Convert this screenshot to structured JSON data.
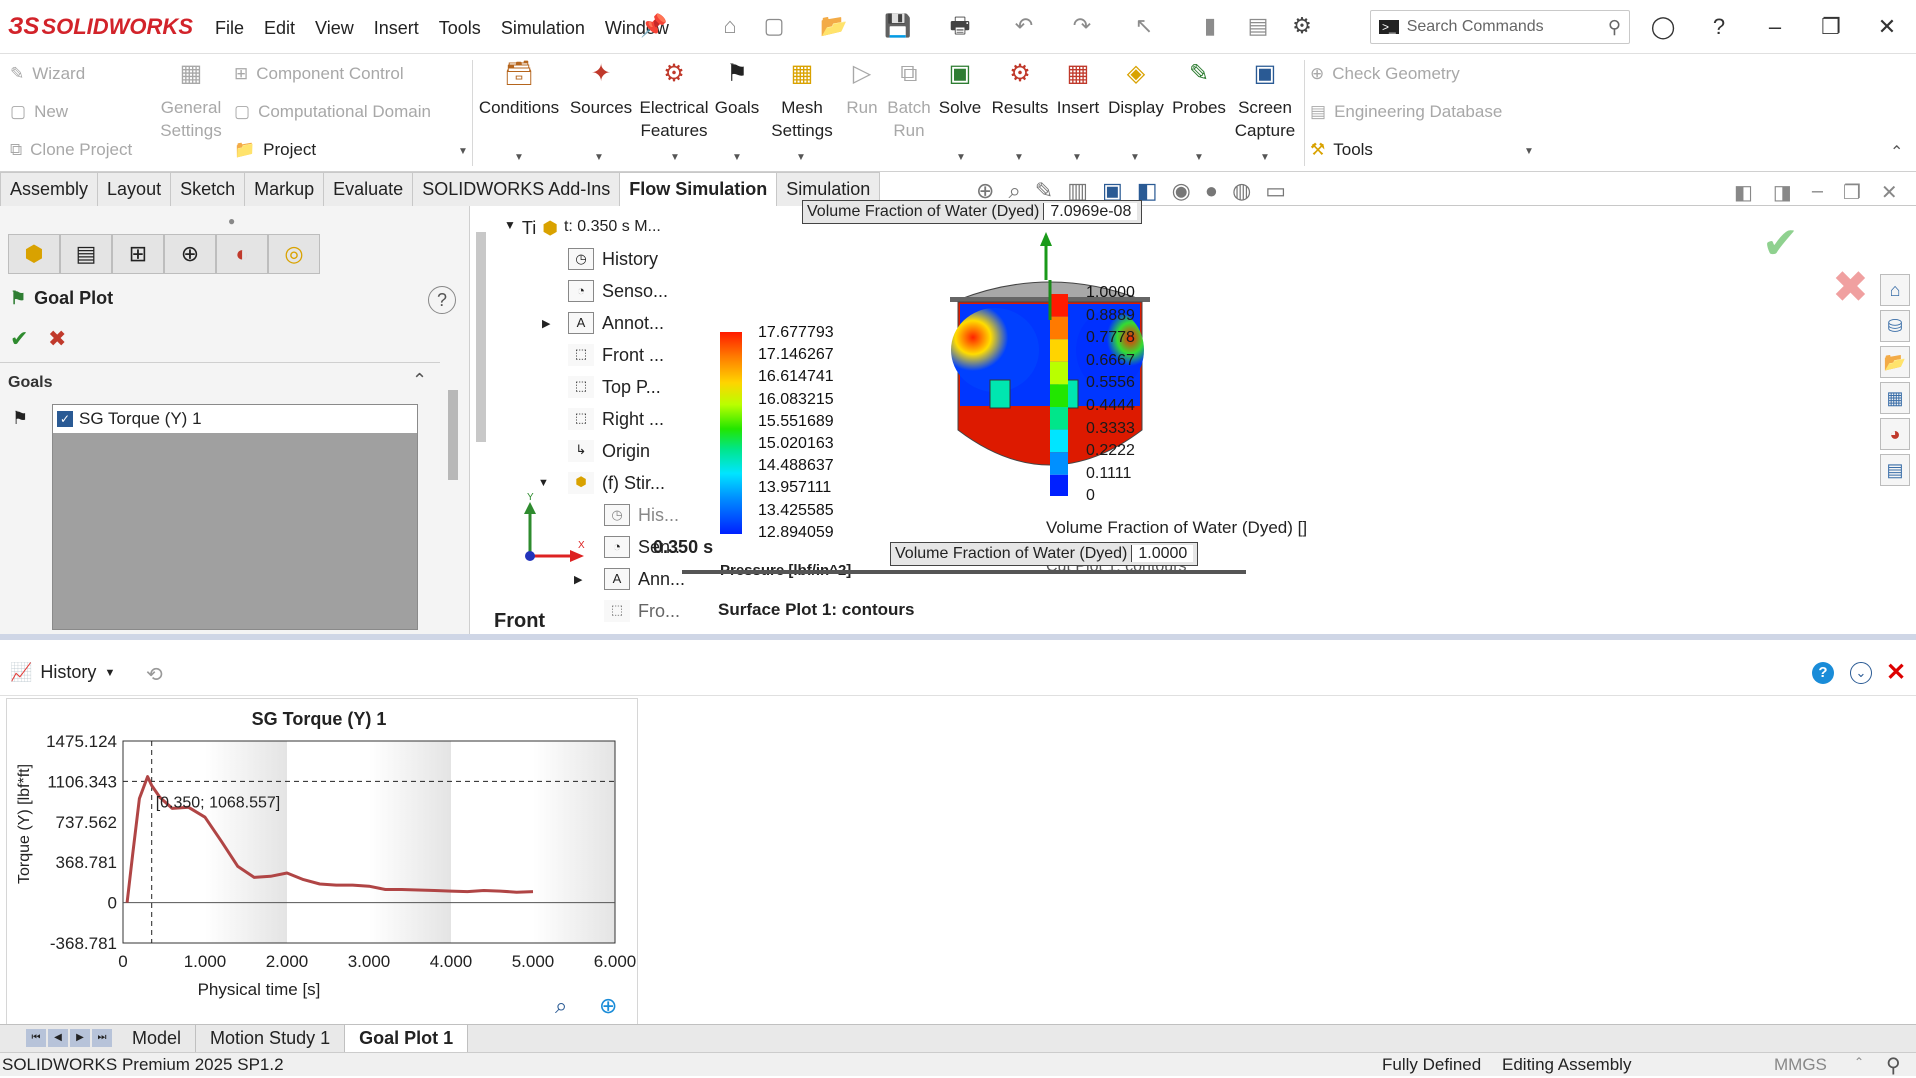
{
  "app": {
    "brand": "SOLIDWORKS",
    "brand_color": "#d2232a"
  },
  "menu": [
    "File",
    "Edit",
    "View",
    "Insert",
    "Tools",
    "Simulation",
    "Window"
  ],
  "search": {
    "placeholder": "Search Commands"
  },
  "ribbon": {
    "left_items": [
      "Wizard",
      "New",
      "Clone Project"
    ],
    "general_settings": [
      "General",
      "Settings"
    ],
    "mid_items": [
      "Component Control",
      "Computational Domain",
      "Project"
    ],
    "buttons": [
      {
        "l1": "Conditions",
        "l2": ""
      },
      {
        "l1": "Sources",
        "l2": ""
      },
      {
        "l1": "Electrical",
        "l2": "Features"
      },
      {
        "l1": "Goals",
        "l2": ""
      },
      {
        "l1": "Mesh",
        "l2": "Settings"
      },
      {
        "l1": "Run",
        "l2": ""
      },
      {
        "l1": "Batch",
        "l2": "Run"
      },
      {
        "l1": "Solve",
        "l2": ""
      },
      {
        "l1": "Results",
        "l2": ""
      },
      {
        "l1": "Insert",
        "l2": ""
      },
      {
        "l1": "Display",
        "l2": ""
      },
      {
        "l1": "Probes",
        "l2": ""
      },
      {
        "l1": "Screen",
        "l2": "Capture"
      }
    ],
    "right_items": [
      "Check Geometry",
      "Engineering Database",
      "Tools"
    ]
  },
  "tabs": [
    "Assembly",
    "Layout",
    "Sketch",
    "Markup",
    "Evaluate",
    "SOLIDWORKS Add-Ins",
    "Flow Simulation",
    "Simulation"
  ],
  "active_tab": "Flow Simulation",
  "panel": {
    "title": "Goal Plot",
    "section": "Goals",
    "goal_item": "SG Torque (Y) 1"
  },
  "tree": {
    "top": "Ti",
    "overlay": "t: 0.350 s M...",
    "items": [
      "History",
      "Senso...",
      "Annot...",
      "Front ...",
      "Top P...",
      "Right ...",
      "Origin",
      "(f) Stir...",
      "His...",
      "Sen...",
      "Ann...",
      "Fro..."
    ],
    "overlay_time": "0.350 s",
    "view_label": "Front"
  },
  "legend": {
    "values": [
      "17.677793",
      "17.146267",
      "16.614741",
      "16.083215",
      "15.551689",
      "15.020163",
      "14.488637",
      "13.957111",
      "13.425585",
      "12.894059"
    ],
    "unit_label": "Pressure [lbf/in^2]",
    "surface_label": "Surface Plot 1: contours"
  },
  "viewport": {
    "tooltip1_label": "Volume Fraction of Water (Dyed)",
    "tooltip1_value": "7.0969e-08",
    "tooltip2_label": "Volume Fraction of Water (Dyed)",
    "tooltip2_value": "1.0000",
    "scale_values": [
      "1.0000",
      "0.8889",
      "0.7778",
      "0.6667",
      "0.5556",
      "0.4444",
      "0.3333",
      "0.2222",
      "0.1111",
      "0"
    ],
    "scale_title": "Volume Fraction of Water (Dyed) []",
    "cut_label": "Cut Plot 1: contours",
    "axis_x": "X",
    "axis_y": "Y"
  },
  "history_bar": {
    "label": "History"
  },
  "chart_data": {
    "type": "line",
    "title": "SG Torque (Y) 1",
    "xlabel": "Physical time [s]",
    "ylabel": "Torque (Y) [lbf*ft]",
    "xlim": [
      0,
      6
    ],
    "ylim": [
      -368.781,
      1475.124
    ],
    "x_ticks": [
      "0",
      "1.000",
      "2.000",
      "3.000",
      "4.000",
      "5.000",
      "6.000"
    ],
    "y_ticks": [
      "1475.124",
      "1106.343",
      "737.562",
      "368.781",
      "0",
      "-368.781"
    ],
    "series": [
      {
        "color": "#b04545",
        "x": [
          0.05,
          0.12,
          0.2,
          0.3,
          0.35,
          0.45,
          0.6,
          0.8,
          1.0,
          1.2,
          1.4,
          1.6,
          1.8,
          2.0,
          2.2,
          2.4,
          2.6,
          2.8,
          3.0,
          3.2,
          3.4,
          3.6,
          3.8,
          4.0,
          4.2,
          4.4,
          4.6,
          4.8,
          5.0
        ],
        "y": [
          0,
          450,
          950,
          1150,
          1068.557,
          960,
          860,
          870,
          780,
          560,
          330,
          230,
          240,
          270,
          210,
          170,
          160,
          160,
          150,
          120,
          120,
          115,
          110,
          105,
          100,
          110,
          105,
          95,
          100
        ]
      }
    ],
    "annotation": "[0.350; 1068.557]",
    "marker": {
      "x": 0.35,
      "y": 1068.557
    }
  },
  "bottom_tabs": [
    "Model",
    "Motion Study 1",
    "Goal Plot 1"
  ],
  "status": {
    "left": "SOLIDWORKS Premium 2025 SP1.2",
    "state": "Fully Defined",
    "mode": "Editing Assembly",
    "units": "MMGS"
  }
}
